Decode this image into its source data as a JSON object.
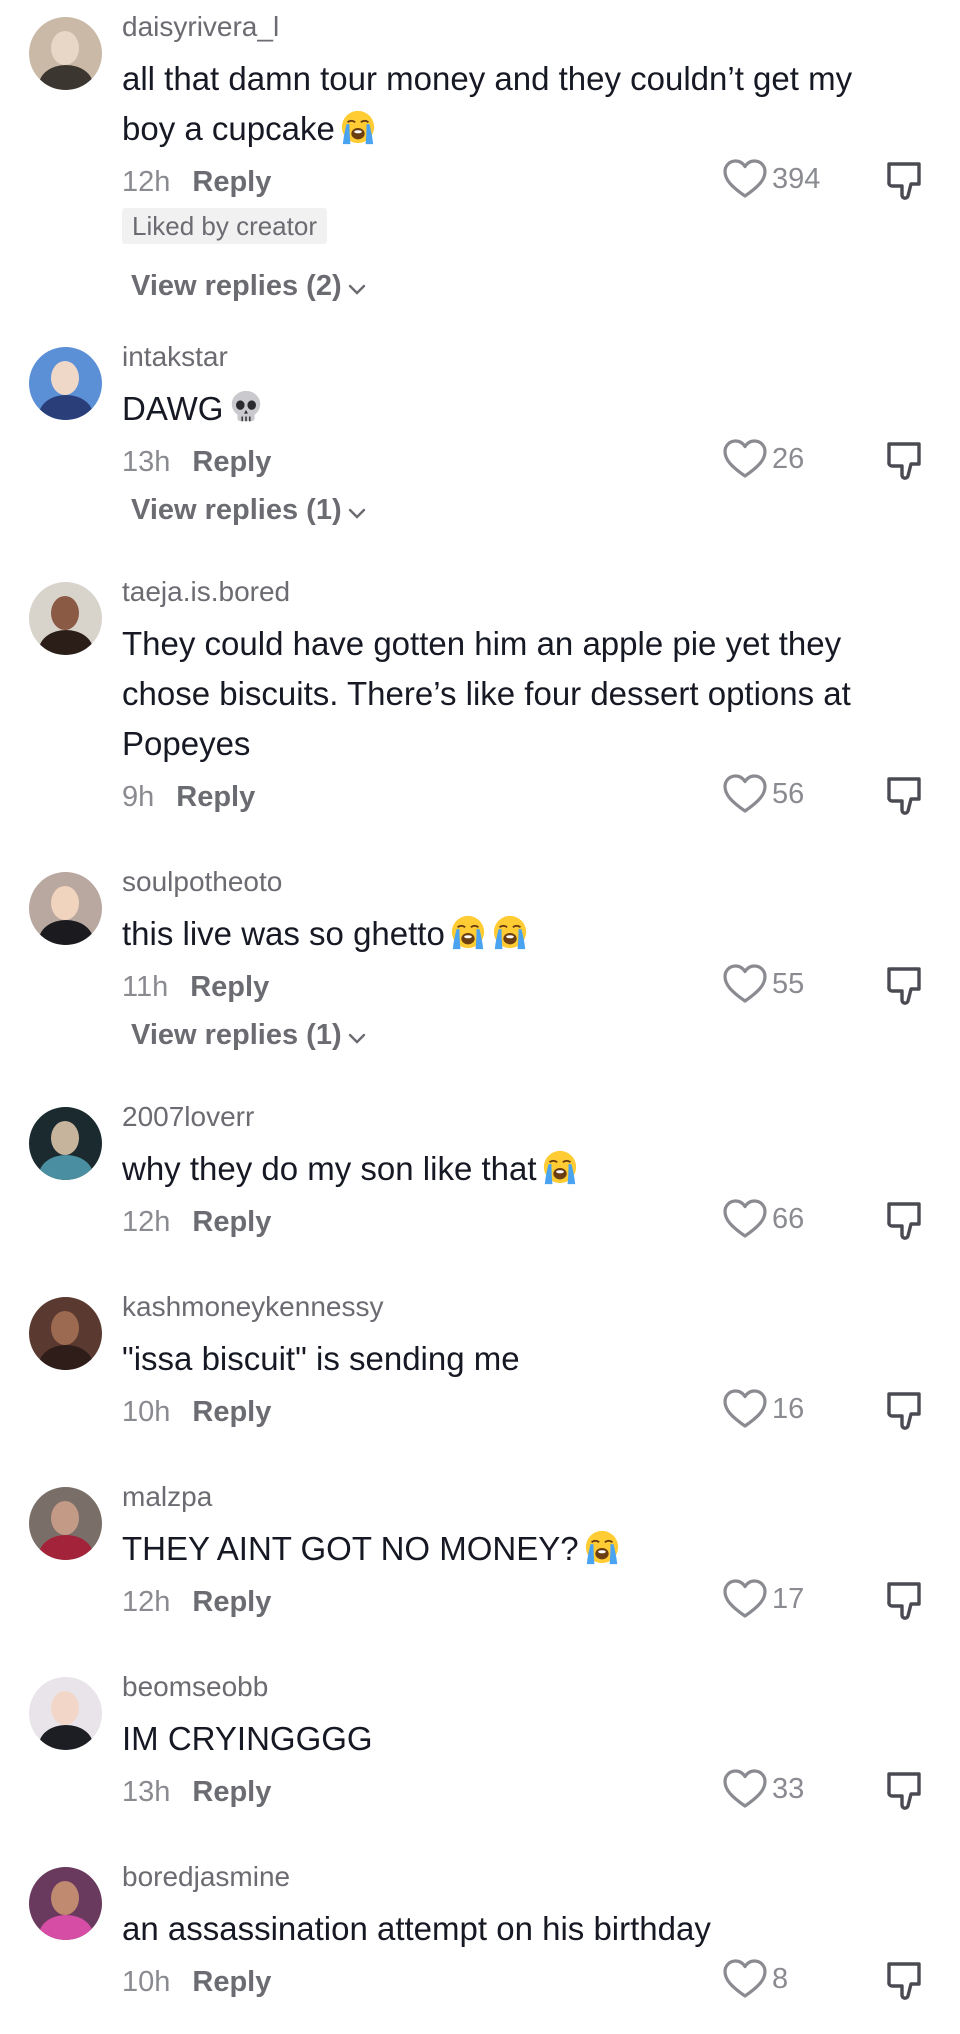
{
  "comments": [
    {
      "username": "daisyrivera_l",
      "text": "all that damn tour money and they couldn’t get my boy a cupcake",
      "emoji": [
        "crying"
      ],
      "time": "12h",
      "reply_label": "Reply",
      "likes": "394",
      "badge": "Liked by creator",
      "view_replies": "View replies (2)",
      "avatar_colors": {
        "bg": "#c9b9a6",
        "face": "#e8d6c6",
        "body": "#3c3630"
      }
    },
    {
      "username": "intakstar",
      "text": "DAWG",
      "emoji": [
        "skull"
      ],
      "time": "13h",
      "reply_label": "Reply",
      "likes": "26",
      "view_replies": "View replies (1)",
      "avatar_colors": {
        "bg": "#5b8fd6",
        "face": "#f0d8c8",
        "body": "#2a3f7a"
      }
    },
    {
      "username": "taeja.is.bored",
      "text": "They could have gotten him an apple pie yet they chose biscuits. There’s like four dessert options at Popeyes",
      "emoji": [],
      "time": "9h",
      "reply_label": "Reply",
      "likes": "56",
      "avatar_colors": {
        "bg": "#d8d4cc",
        "face": "#8a5a44",
        "body": "#2b1d18"
      }
    },
    {
      "username": "soulpotheoto",
      "text": "this live was so ghetto",
      "emoji": [
        "crying",
        "crying"
      ],
      "time": "11h",
      "reply_label": "Reply",
      "likes": "55",
      "view_replies": "View replies (1)",
      "avatar_colors": {
        "bg": "#b9a8a0",
        "face": "#f1d4bd",
        "body": "#1b1b1f"
      }
    },
    {
      "username": "2007loverr",
      "text": "why they do my son like that",
      "emoji": [
        "crying"
      ],
      "time": "12h",
      "reply_label": "Reply",
      "likes": "66",
      "avatar_colors": {
        "bg": "#1a2a2e",
        "face": "#c7b49c",
        "body": "#4a8fa1"
      }
    },
    {
      "username": "kashmoneykennessy",
      "text": "\"issa biscuit\" is sending me",
      "emoji": [],
      "time": "10h",
      "reply_label": "Reply",
      "likes": "16",
      "avatar_colors": {
        "bg": "#5a3a30",
        "face": "#9c6a50",
        "body": "#2e1d18"
      }
    },
    {
      "username": "malzpa",
      "text": "THEY AINT GOT NO MONEY?",
      "emoji": [
        "crying"
      ],
      "time": "12h",
      "reply_label": "Reply",
      "likes": "17",
      "avatar_colors": {
        "bg": "#7a6e68",
        "face": "#c39a86",
        "body": "#a3233a"
      }
    },
    {
      "username": "beomseobb",
      "text": "IM CRYINGGGG",
      "emoji": [],
      "time": "13h",
      "reply_label": "Reply",
      "likes": "33",
      "avatar_colors": {
        "bg": "#e9e4ea",
        "face": "#f2d7c8",
        "body": "#1d1d24"
      }
    },
    {
      "username": "boredjasmine",
      "text": "an assassination attempt on his birthday",
      "emoji": [],
      "time": "10h",
      "reply_label": "Reply",
      "likes": "8",
      "avatar_colors": {
        "bg": "#6a3a5e",
        "face": "#c08a70",
        "body": "#d64da6"
      }
    }
  ]
}
